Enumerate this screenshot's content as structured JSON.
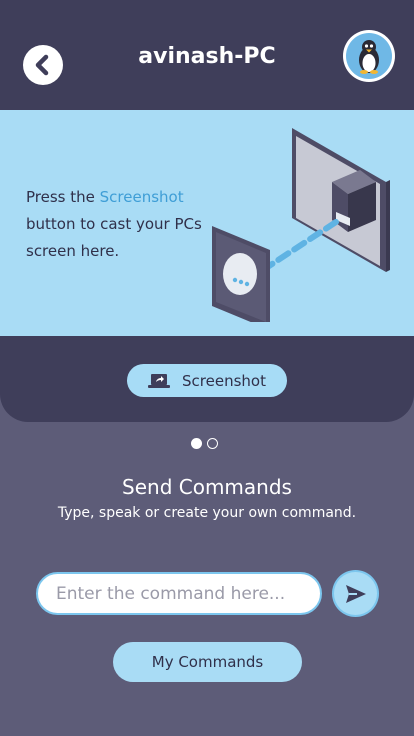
{
  "header": {
    "title": "avinash-PC",
    "back_icon": "chevron-left-icon",
    "avatar_icon": "linux-penguin-icon"
  },
  "banner": {
    "text_before": "Press the ",
    "text_highlight": "Screenshot",
    "text_after": " button to cast your PCs screen here.",
    "illustration": "monitor-projector-illustration"
  },
  "screenshot_button": {
    "label": "Screenshot",
    "icon": "laptop-share-icon"
  },
  "pager": {
    "total": 2,
    "active": 1
  },
  "commands": {
    "title": "Send Commands",
    "subtitle": "Type, speak or create your own command.",
    "input_placeholder": "Enter the command here...",
    "input_value": "",
    "send_icon": "send-icon",
    "my_commands_label": "My Commands"
  },
  "colors": {
    "background": "#5d5c78",
    "panel": "#3f3e5a",
    "accent": "#a9dcf5",
    "highlight_text": "#3f9ed6"
  }
}
